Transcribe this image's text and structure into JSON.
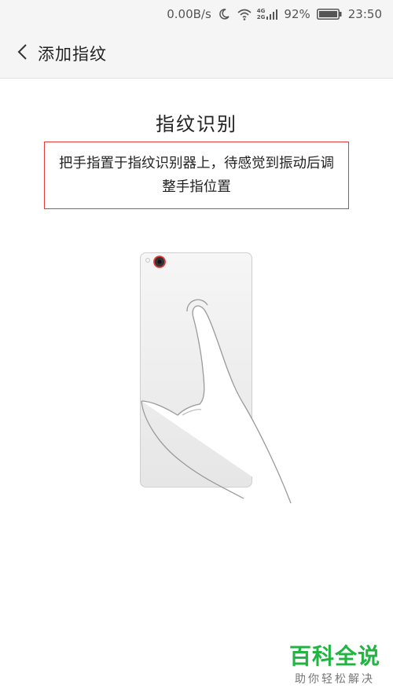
{
  "status_bar": {
    "net_speed": "0.00B/s",
    "net_type_top": "4G",
    "net_type_bottom": "2G",
    "battery_pct": "92%",
    "time": "23:50"
  },
  "header": {
    "title": "添加指纹",
    "back_icon": "chevron-left-icon"
  },
  "main": {
    "section_title": "指纹识别",
    "instruction": "把手指置于指纹识别器上，待感觉到振动后调整手指位置",
    "accent_color": "#e23b3b"
  },
  "watermark": {
    "title": "百科全说",
    "subtitle": "助你轻松解决",
    "color": "#21b441"
  }
}
